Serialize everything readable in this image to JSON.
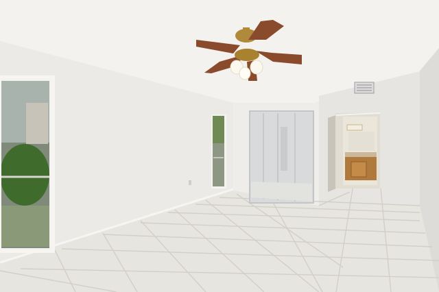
{
  "scene": {
    "kind": "interior-photo",
    "room": "empty bedroom",
    "fixtures": [
      "ceiling-fan",
      "mirrored-closet-doors",
      "window",
      "side-window",
      "doorway-to-bathroom",
      "air-vent",
      "wall-outlet",
      "bathroom-vanity",
      "vanity-light"
    ],
    "colors": {
      "ceiling": "#f3f2ee",
      "wall": "#ebeae6",
      "wall_shadow": "#dcdad5",
      "floor_tile": "#e7e5df",
      "grout": "#cfcbc2",
      "fan_blade": "#8a4a2c",
      "fan_brass": "#b08a3a",
      "mirror": "#d9dadb",
      "vanity_wood": "#b07a3c",
      "window_glass": "#7f8a7a",
      "foliage": "#3f6b2c"
    }
  }
}
